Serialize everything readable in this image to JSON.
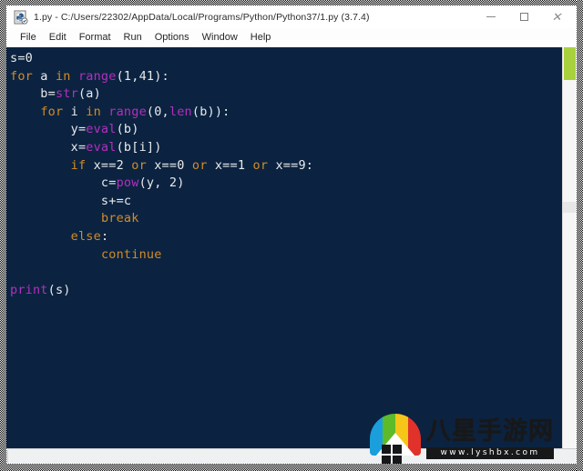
{
  "window": {
    "title": "1.py - C:/Users/22302/AppData/Local/Programs/Python/Python37/1.py (3.7.4)",
    "app_icon": "python-idle-icon",
    "controls": {
      "minimize": "–",
      "maximize": "□",
      "close": "×"
    }
  },
  "menubar": {
    "items": [
      {
        "label": "File"
      },
      {
        "label": "Edit"
      },
      {
        "label": "Format"
      },
      {
        "label": "Run"
      },
      {
        "label": "Options"
      },
      {
        "label": "Window"
      },
      {
        "label": "Help"
      }
    ]
  },
  "editor": {
    "background": "#0b2340",
    "text_color": "#e9eaec",
    "keyword_color": "#d38b28",
    "builtin_color": "#b32fbe",
    "font_size_px": 13.5,
    "lines": [
      [
        {
          "t": "s=0",
          "c": "pl"
        }
      ],
      [
        {
          "t": "for",
          "c": "kw"
        },
        {
          "t": " a ",
          "c": "pl"
        },
        {
          "t": "in",
          "c": "kw"
        },
        {
          "t": " ",
          "c": "pl"
        },
        {
          "t": "range",
          "c": "bi"
        },
        {
          "t": "(1,41):",
          "c": "pl"
        }
      ],
      [
        {
          "t": "    b=",
          "c": "pl"
        },
        {
          "t": "str",
          "c": "bi"
        },
        {
          "t": "(a)",
          "c": "pl"
        }
      ],
      [
        {
          "t": "    ",
          "c": "pl"
        },
        {
          "t": "for",
          "c": "kw"
        },
        {
          "t": " i ",
          "c": "pl"
        },
        {
          "t": "in",
          "c": "kw"
        },
        {
          "t": " ",
          "c": "pl"
        },
        {
          "t": "range",
          "c": "bi"
        },
        {
          "t": "(0,",
          "c": "pl"
        },
        {
          "t": "len",
          "c": "bi"
        },
        {
          "t": "(b)):",
          "c": "pl"
        }
      ],
      [
        {
          "t": "        y=",
          "c": "pl"
        },
        {
          "t": "eval",
          "c": "bi"
        },
        {
          "t": "(b)",
          "c": "pl"
        }
      ],
      [
        {
          "t": "        x=",
          "c": "pl"
        },
        {
          "t": "eval",
          "c": "bi"
        },
        {
          "t": "(b[i])",
          "c": "pl"
        }
      ],
      [
        {
          "t": "        ",
          "c": "pl"
        },
        {
          "t": "if",
          "c": "kw"
        },
        {
          "t": " x==2 ",
          "c": "pl"
        },
        {
          "t": "or",
          "c": "kw"
        },
        {
          "t": " x==0 ",
          "c": "pl"
        },
        {
          "t": "or",
          "c": "kw"
        },
        {
          "t": " x==1 ",
          "c": "pl"
        },
        {
          "t": "or",
          "c": "kw"
        },
        {
          "t": " x==9:",
          "c": "pl"
        }
      ],
      [
        {
          "t": "            c=",
          "c": "pl"
        },
        {
          "t": "pow",
          "c": "bi"
        },
        {
          "t": "(y, 2)",
          "c": "pl"
        }
      ],
      [
        {
          "t": "            s+=c",
          "c": "pl"
        }
      ],
      [
        {
          "t": "            ",
          "c": "pl"
        },
        {
          "t": "break",
          "c": "kw"
        }
      ],
      [
        {
          "t": "        ",
          "c": "pl"
        },
        {
          "t": "else",
          "c": "kw"
        },
        {
          "t": ":",
          "c": "pl"
        }
      ],
      [
        {
          "t": "            ",
          "c": "pl"
        },
        {
          "t": "continue",
          "c": "kw"
        }
      ],
      [
        {
          "t": "",
          "c": "pl"
        }
      ],
      [
        {
          "t": "print",
          "c": "bi"
        },
        {
          "t": "(s)",
          "c": "pl"
        }
      ]
    ]
  },
  "scrollbars": {
    "vertical_thumb_color": "#a9d13d",
    "vertical_thumb_position": "top",
    "horizontal_visible": true
  },
  "watermark": {
    "brand_cn": "八星手游网",
    "url": "www.lyshbx.com",
    "logo_name": "house-arch-logo",
    "logo_colors": [
      "#1a9fdc",
      "#5dbb2a",
      "#f5c518",
      "#e0322a"
    ]
  }
}
